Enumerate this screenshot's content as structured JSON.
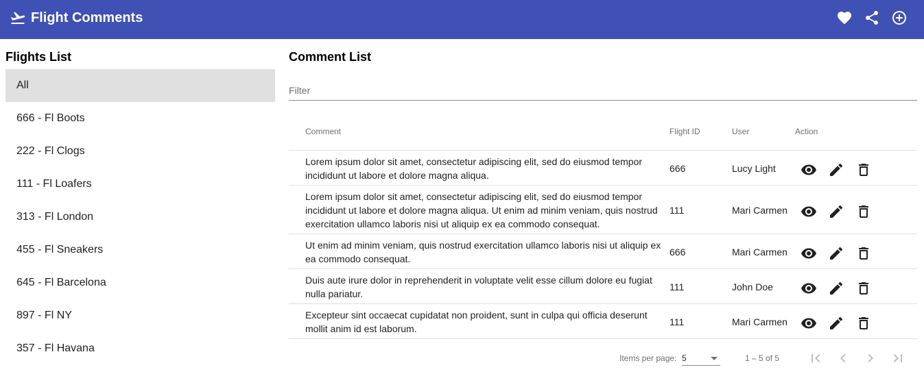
{
  "app": {
    "title": "Flight Comments",
    "icon": "flight-takeoff-icon"
  },
  "toolbar": {
    "actions": [
      {
        "icon": "favorite-icon"
      },
      {
        "icon": "share-icon"
      },
      {
        "icon": "add-circle-icon"
      }
    ]
  },
  "colors": {
    "primary": "#3f51b5",
    "selected_bg": "#e0e0e0"
  },
  "flights_panel": {
    "heading": "Flights List",
    "items": [
      {
        "label": "All",
        "selected": true
      },
      {
        "label": "666 - Fl Boots"
      },
      {
        "label": "222 - Fl Clogs"
      },
      {
        "label": "111 - Fl Loafers"
      },
      {
        "label": "313 - Fl London"
      },
      {
        "label": "455 - Fl Sneakers"
      },
      {
        "label": "645 - Fl Barcelona"
      },
      {
        "label": "897 - Fl NY"
      },
      {
        "label": "357 - Fl Havana"
      }
    ]
  },
  "comments_panel": {
    "heading": "Comment List",
    "filter": {
      "placeholder": "Filter",
      "value": ""
    },
    "columns": {
      "comment": "Comment",
      "flight_id": "Flight ID",
      "user": "User",
      "action": "Action"
    },
    "rows": [
      {
        "comment_lines": [
          "Lorem ipsum dolor sit amet, consectetur adipiscing elit, sed do eiusmod tempor",
          "incididunt ut labore et dolore magna aliqua."
        ],
        "flight_id": "666",
        "user": "Lucy Light"
      },
      {
        "comment_lines": [
          "Lorem ipsum dolor sit amet, consectetur adipiscing elit, sed do eiusmod tempor",
          "incididunt ut labore et dolore magna aliqua. Ut enim ad minim veniam, quis nostrud",
          "exercitation ullamco laboris nisi ut aliquip ex ea commodo consequat."
        ],
        "flight_id": "111",
        "user": "Mari Carmen"
      },
      {
        "comment_lines": [
          "Ut enim ad minim veniam, quis nostrud exercitation ullamco laboris nisi ut aliquip ex",
          "ea commodo consequat."
        ],
        "flight_id": "666",
        "user": "Mari Carmen"
      },
      {
        "comment_lines": [
          "Duis aute irure dolor in reprehenderit in voluptate velit esse cillum dolore eu fugiat",
          "nulla pariatur."
        ],
        "flight_id": "111",
        "user": "John Doe"
      },
      {
        "comment_lines": [
          "Excepteur sint occaecat cupidatat non proident, sunt in culpa qui officia deserunt",
          "mollit anim id est laborum."
        ],
        "flight_id": "111",
        "user": "Mari Carmen"
      }
    ],
    "row_actions": [
      {
        "icon": "visibility-icon"
      },
      {
        "icon": "edit-icon"
      },
      {
        "icon": "delete-icon"
      }
    ]
  },
  "paginator": {
    "items_per_page_label": "Items per page:",
    "page_size": "5",
    "range_label": "1 – 5 of 5",
    "buttons": [
      {
        "icon": "first-page-icon"
      },
      {
        "icon": "previous-page-icon"
      },
      {
        "icon": "next-page-icon"
      },
      {
        "icon": "last-page-icon"
      }
    ]
  }
}
